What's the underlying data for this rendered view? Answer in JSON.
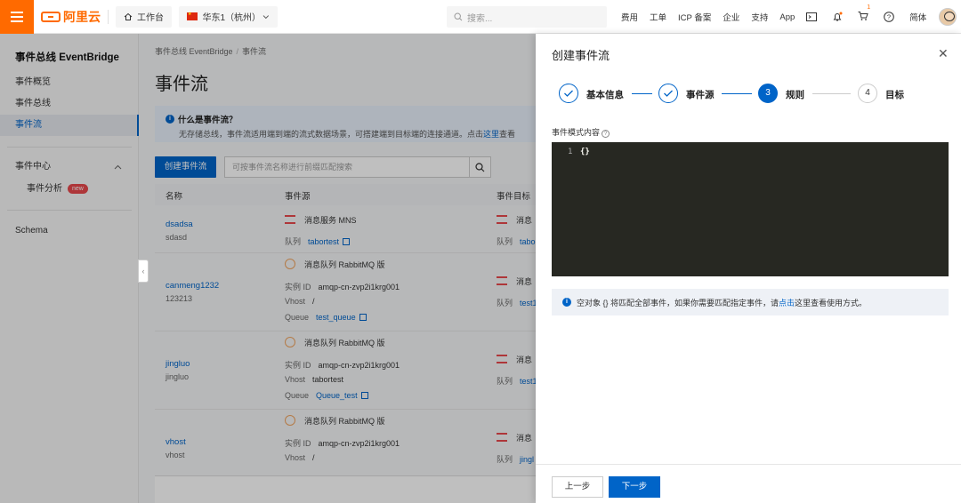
{
  "topbar": {
    "logo_text": "阿里云",
    "workbench": "工作台",
    "region": "华东1（杭州）",
    "search_placeholder": "搜索...",
    "nav": [
      "费用",
      "工单",
      "ICP 备案",
      "企业",
      "支持",
      "App"
    ],
    "cart_count": "1",
    "lang": "简体"
  },
  "sidebar": {
    "title": "事件总线 EventBridge",
    "items": [
      "事件概览",
      "事件总线",
      "事件流"
    ],
    "group": "事件中心",
    "sub_item": "事件分析",
    "new_badge": "new",
    "schema": "Schema"
  },
  "main": {
    "breadcrumb": [
      "事件总线 EventBridge",
      "事件流"
    ],
    "title": "事件流",
    "info_question": "什么是事件流？",
    "info_desc": "无存储总线，事件流适用端到端的流式数据场景，可搭建端到目标端的连接通道。点击",
    "info_link": "这里",
    "info_desc_tail": "查看",
    "create_button": "创建事件流",
    "search_placeholder": "可按事件流名称进行前缀匹配搜索",
    "columns": [
      "名称",
      "事件源",
      "事件目标"
    ],
    "rows": [
      {
        "name": "dsadsa",
        "desc": "sdasd",
        "source": "消息服务 MNS",
        "lines": [
          {
            "k": "队列",
            "v": "tabortest",
            "link": true
          }
        ],
        "target_title": "消息",
        "target_k": "队列",
        "target_v": "tabo"
      },
      {
        "name": "canmeng1232",
        "desc": "123213",
        "source": "消息队列 RabbitMQ 版",
        "lines": [
          {
            "k": "实例 ID",
            "v": "amqp-cn-zvp2i1krg001",
            "link": false
          },
          {
            "k": "Vhost",
            "v": "/",
            "link": false
          },
          {
            "k": "Queue",
            "v": "test_queue",
            "link": true
          }
        ],
        "target_title": "消息",
        "target_k": "队列",
        "target_v": "test1"
      },
      {
        "name": "jingluo",
        "desc": "jingluo",
        "source": "消息队列 RabbitMQ 版",
        "lines": [
          {
            "k": "实例 ID",
            "v": "amqp-cn-zvp2i1krg001",
            "link": false
          },
          {
            "k": "Vhost",
            "v": "tabortest",
            "link": false
          },
          {
            "k": "Queue",
            "v": "Queue_test",
            "link": true
          }
        ],
        "target_title": "消息",
        "target_k": "队列",
        "target_v": "test1"
      },
      {
        "name": "vhost",
        "desc": "vhost",
        "source": "消息队列 RabbitMQ 版",
        "lines": [
          {
            "k": "实例 ID",
            "v": "amqp-cn-zvp2i1krg001",
            "link": false
          },
          {
            "k": "Vhost",
            "v": "/",
            "link": false
          }
        ],
        "target_title": "消息",
        "target_k": "队列",
        "target_v": "jingl"
      }
    ]
  },
  "drawer": {
    "title": "创建事件流",
    "steps": [
      {
        "label": "基本信息",
        "state": "done"
      },
      {
        "label": "事件源",
        "state": "done"
      },
      {
        "label": "规则",
        "state": "current",
        "num": "3"
      },
      {
        "label": "目标",
        "state": "todo",
        "num": "4"
      }
    ],
    "field_label": "事件模式内容",
    "editor_line": "1",
    "editor_code": "{}",
    "note_text": "空对象 {} 将匹配全部事件，如果你需要匹配指定事件，请",
    "note_link": "点击",
    "note_tail": "这里查看使用方式。",
    "prev_button": "上一步",
    "next_button": "下一步"
  },
  "colors": {
    "accent": "#0064c8",
    "brand": "#ff6a00",
    "editor_bg": "#272822"
  }
}
